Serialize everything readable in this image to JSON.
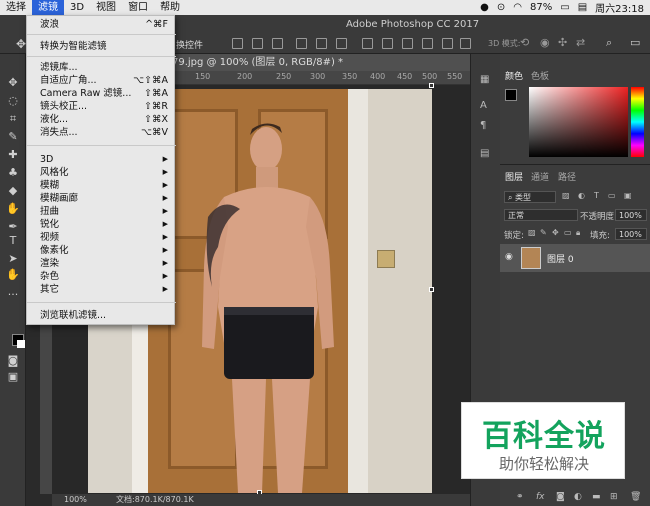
{
  "mac_menu": {
    "items": [
      "选择",
      "滤镜",
      "3D",
      "视图",
      "窗口",
      "帮助"
    ],
    "active_index": 1,
    "right": {
      "battery": "87%",
      "datetime": "周六23:18"
    }
  },
  "app_title": "Adobe Photoshop CC 2017",
  "options_bar": {
    "transform_label": "换控件",
    "mode_3d": "3D 模式:"
  },
  "document_tab": "79.jpg @ 100% (图层 0, RGB/8#) *",
  "ruler_ticks": [
    "150",
    "200",
    "250",
    "300",
    "350",
    "400",
    "450",
    "500",
    "550"
  ],
  "status_bar": {
    "zoom": "100%",
    "doc_info": "文档:870.1K/870.1K"
  },
  "filter_menu": {
    "items": [
      {
        "label": "波浪",
        "shortcut": "^⌘F"
      },
      {
        "label": "转换为智能滤镜",
        "shortcut": ""
      },
      {
        "label": "滤镜库...",
        "shortcut": ""
      },
      {
        "label": "自适应广角...",
        "shortcut": "⌥⇧⌘A"
      },
      {
        "label": "Camera Raw 滤镜...",
        "shortcut": "⇧⌘A"
      },
      {
        "label": "镜头校正...",
        "shortcut": "⇧⌘R"
      },
      {
        "label": "液化...",
        "shortcut": "⇧⌘X"
      },
      {
        "label": "消失点...",
        "shortcut": "⌥⌘V"
      },
      {
        "label": "3D",
        "shortcut": ""
      },
      {
        "label": "风格化",
        "shortcut": ""
      },
      {
        "label": "模糊",
        "shortcut": ""
      },
      {
        "label": "模糊画廊",
        "shortcut": ""
      },
      {
        "label": "扭曲",
        "shortcut": ""
      },
      {
        "label": "锐化",
        "shortcut": ""
      },
      {
        "label": "视频",
        "shortcut": ""
      },
      {
        "label": "像素化",
        "shortcut": ""
      },
      {
        "label": "渲染",
        "shortcut": ""
      },
      {
        "label": "杂色",
        "shortcut": ""
      },
      {
        "label": "其它",
        "shortcut": ""
      },
      {
        "label": "浏览联机滤镜...",
        "shortcut": ""
      }
    ]
  },
  "color_panel": {
    "tabs": [
      "颜色",
      "色板"
    ],
    "foreground": "#000000",
    "background": "#ffffff"
  },
  "layers_panel": {
    "tabs": [
      "图层",
      "通道",
      "路径"
    ],
    "kind_filter": "类型",
    "blend_mode": "正常",
    "opacity_label": "不透明度:",
    "opacity_value": "100%",
    "lock_label": "锁定:",
    "fill_label": "填充:",
    "fill_value": "100%",
    "layer_name": "图层 0",
    "bottom_icons": [
      "链接",
      "fx"
    ]
  },
  "watermark": {
    "main": "百科全说",
    "sub": "助你轻松解决"
  }
}
